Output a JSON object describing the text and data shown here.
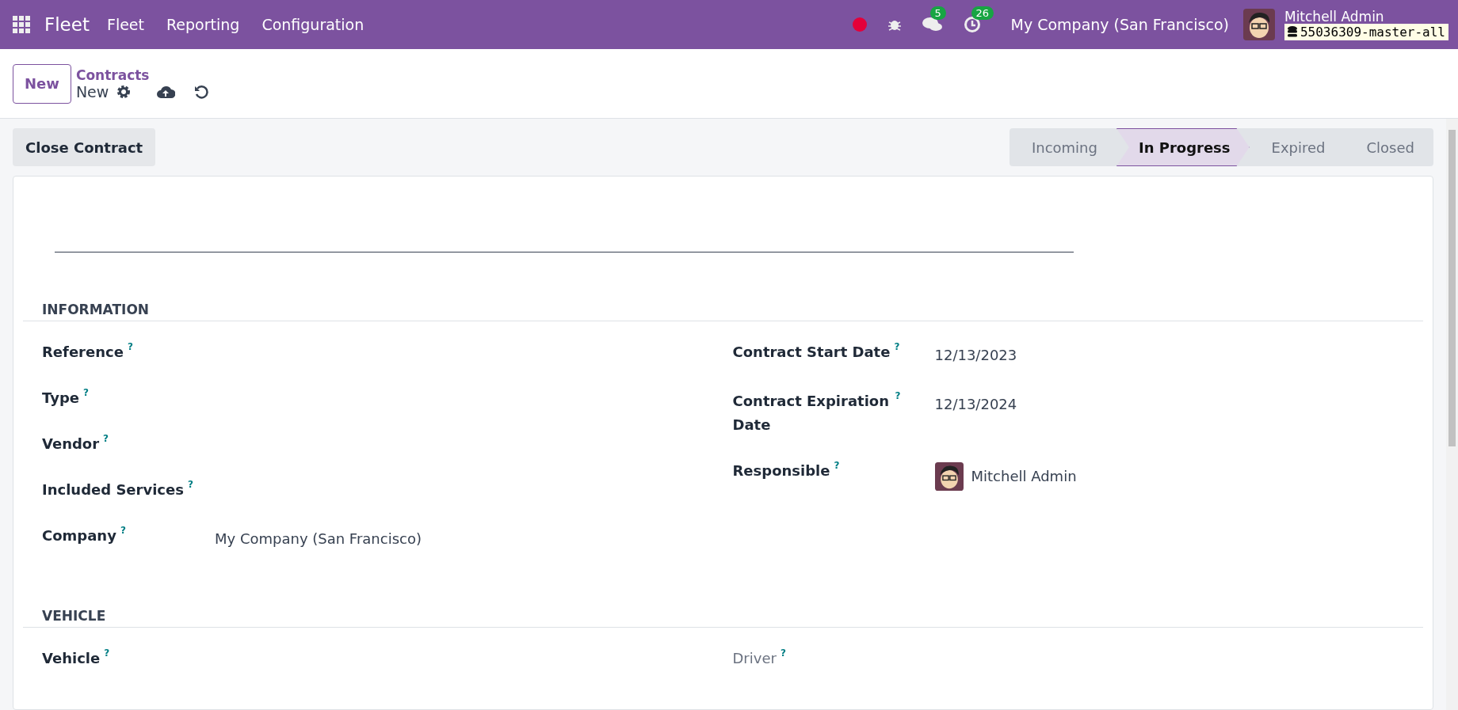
{
  "navbar": {
    "app_name": "Fleet",
    "menus": [
      "Fleet",
      "Reporting",
      "Configuration"
    ],
    "messages_count": "5",
    "activities_count": "26",
    "company": "My Company (San Francisco)",
    "user": "Mitchell Admin",
    "database": "55036309-master-all"
  },
  "control_panel": {
    "new_button": "New",
    "breadcrumb": "Contracts",
    "record": "New"
  },
  "action_button": "Close Contract",
  "stages": [
    {
      "label": "Incoming",
      "selected": false
    },
    {
      "label": "In Progress",
      "selected": true
    },
    {
      "label": "Expired",
      "selected": false
    },
    {
      "label": "Closed",
      "selected": false
    }
  ],
  "sections": [
    {
      "title": "INFORMATION",
      "left": [
        {
          "label": "Reference",
          "muted": false
        },
        {
          "label": "Type",
          "muted": false
        },
        {
          "label": "Vendor",
          "muted": false
        },
        {
          "label": "Included Services",
          "muted": false
        },
        {
          "label": "Company",
          "value": "My Company (San Francisco)",
          "muted": false
        }
      ],
      "right": [
        {
          "label": "Contract Start Date",
          "value": "12/13/2023",
          "muted": false
        },
        {
          "label": "Contract Expiration Date",
          "value": "12/13/2024",
          "muted": false
        },
        {
          "label": "Responsible",
          "value": "Mitchell Admin",
          "kind": "user",
          "muted": false
        }
      ]
    },
    {
      "title": "VEHICLE",
      "left": [
        {
          "label": "Vehicle",
          "muted": false
        }
      ],
      "right": [
        {
          "label": "Driver",
          "muted": true
        }
      ]
    }
  ],
  "help_mark": "?"
}
